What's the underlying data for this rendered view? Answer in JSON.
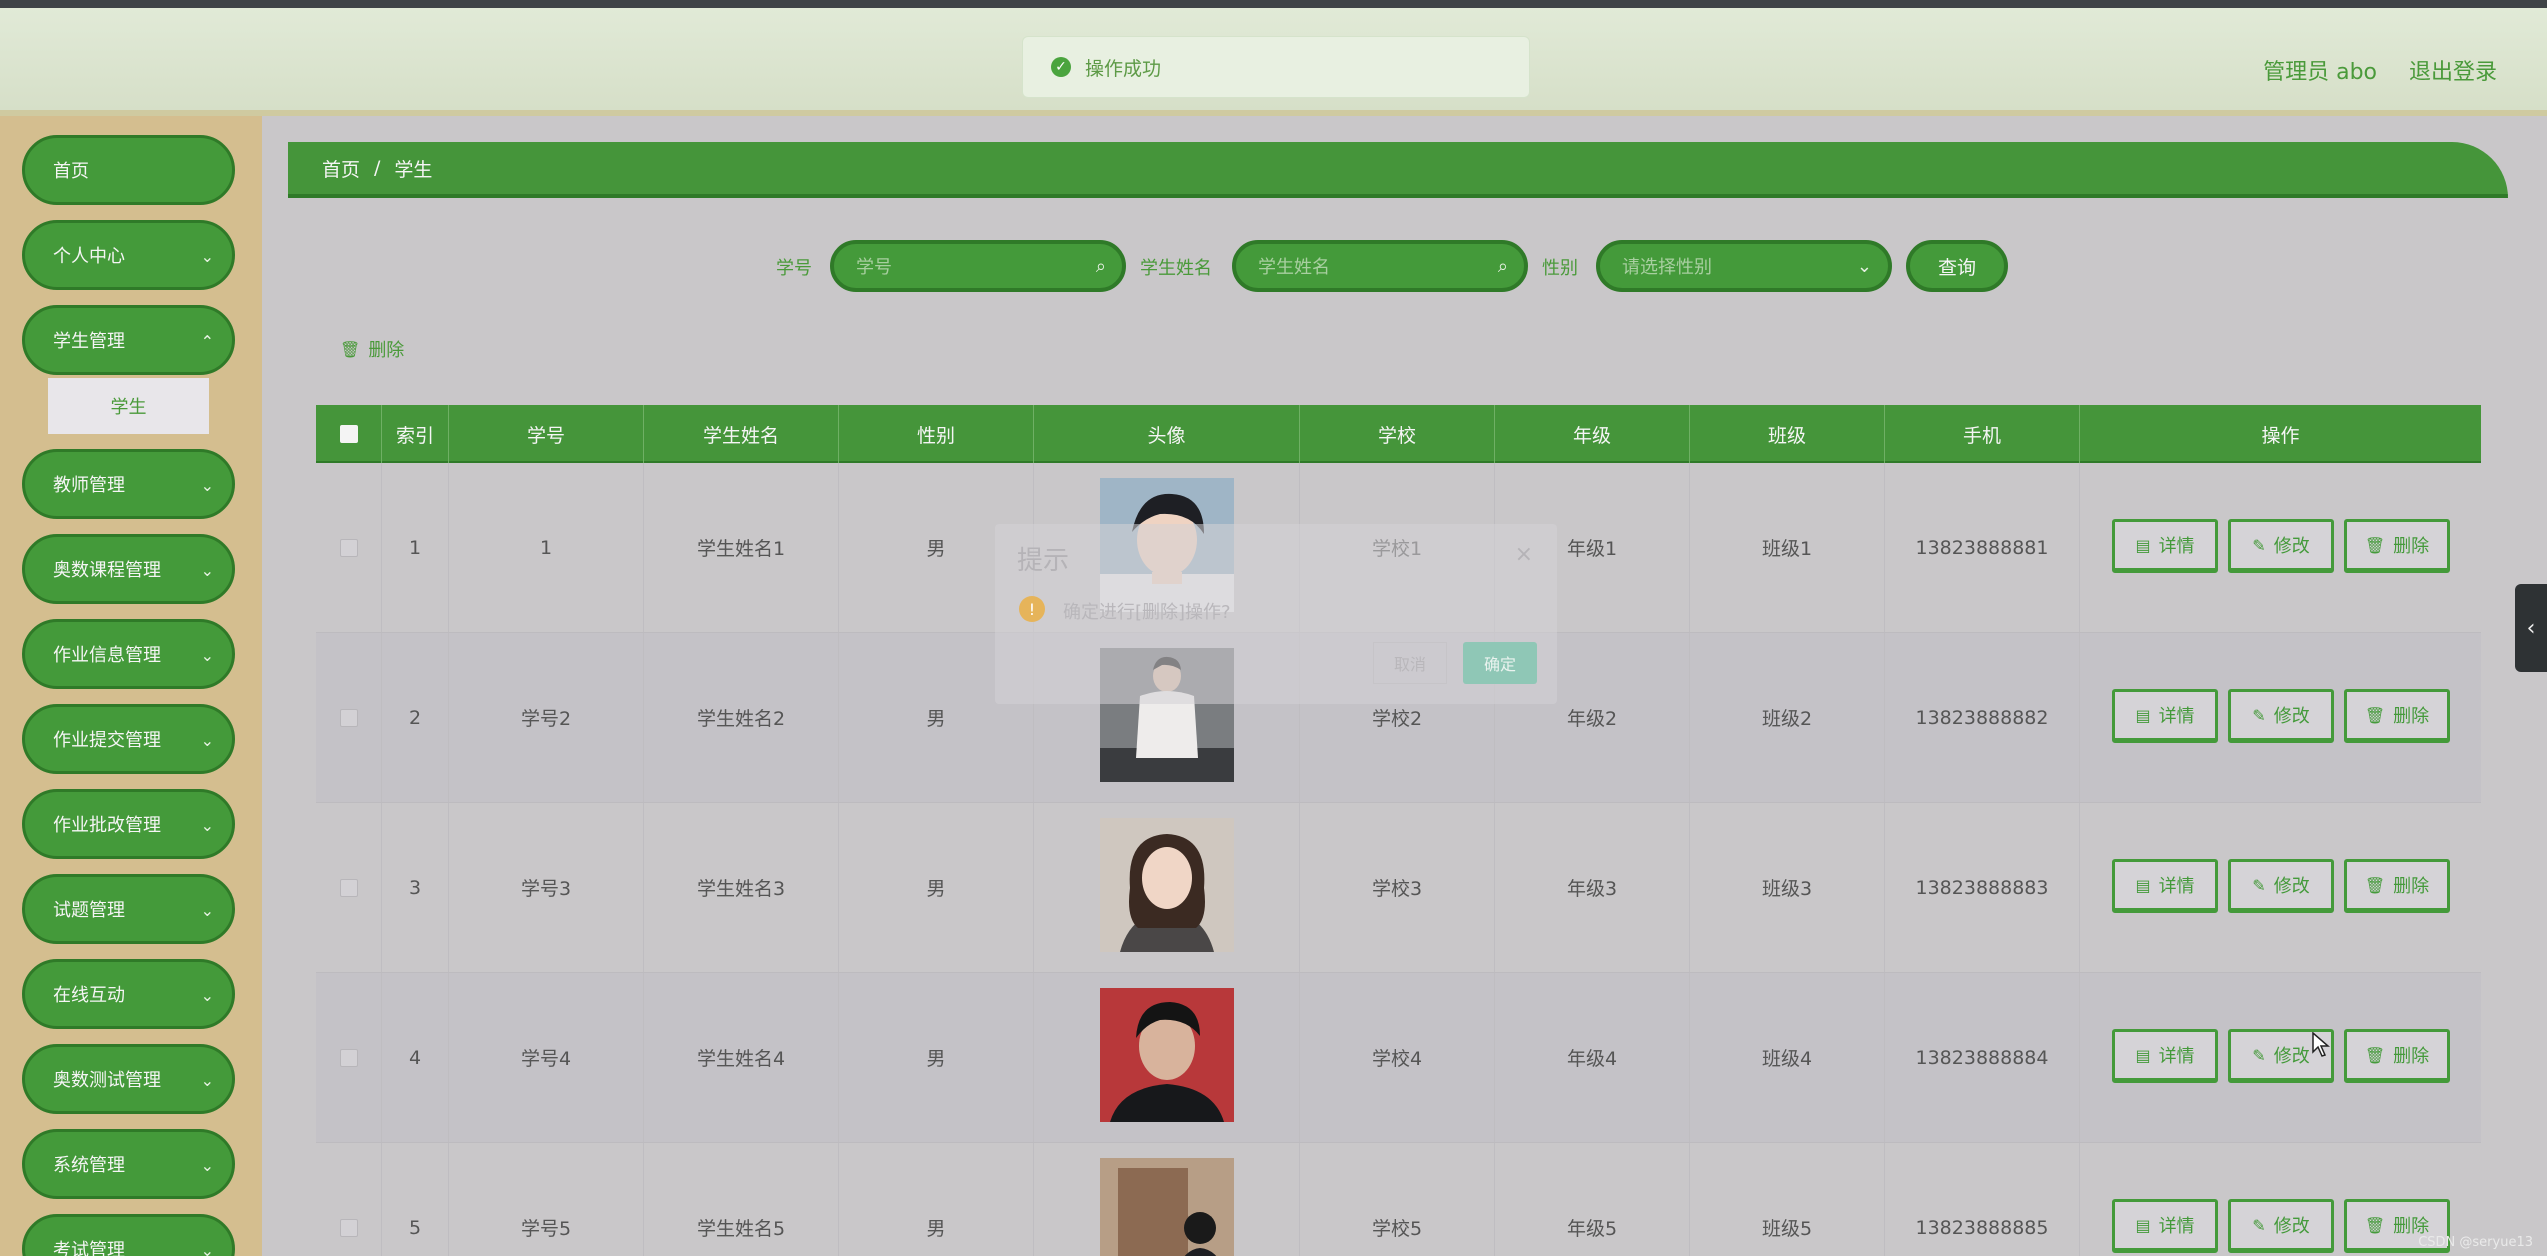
{
  "header": {
    "user": "管理员 abo",
    "logout": "退出登录"
  },
  "toast": {
    "text": "操作成功"
  },
  "sidebar": {
    "items": [
      {
        "label": "首页",
        "has_arrow": false
      },
      {
        "label": "个人中心",
        "has_arrow": true
      },
      {
        "label": "学生管理",
        "has_arrow": true
      },
      {
        "label": "教师管理",
        "has_arrow": true
      },
      {
        "label": "奥数课程管理",
        "has_arrow": true
      },
      {
        "label": "作业信息管理",
        "has_arrow": true
      },
      {
        "label": "作业提交管理",
        "has_arrow": true
      },
      {
        "label": "作业批改管理",
        "has_arrow": true
      },
      {
        "label": "试题管理",
        "has_arrow": true
      },
      {
        "label": "在线互动",
        "has_arrow": true
      },
      {
        "label": "奥数测试管理",
        "has_arrow": true
      },
      {
        "label": "系统管理",
        "has_arrow": true
      },
      {
        "label": "考试管理",
        "has_arrow": true
      }
    ],
    "sub_item": "学生"
  },
  "breadcrumb": {
    "home": "首页",
    "sep": "/",
    "current": "学生"
  },
  "search": {
    "id_label": "学号",
    "id_placeholder": "学号",
    "name_label": "学生姓名",
    "name_placeholder": "学生姓名",
    "gender_label": "性别",
    "gender_placeholder": "请选择性别",
    "query_button": "查询"
  },
  "actions": {
    "delete": "删除"
  },
  "table": {
    "headers": [
      "索引",
      "学号",
      "学生姓名",
      "性别",
      "头像",
      "学校",
      "年级",
      "班级",
      "手机",
      "操作"
    ],
    "rows": [
      {
        "index": "1",
        "id": "1",
        "name": "学生姓名1",
        "gender": "男",
        "school": "学校1",
        "grade": "年级1",
        "class": "班级1",
        "phone": "13823888881"
      },
      {
        "index": "2",
        "id": "学号2",
        "name": "学生姓名2",
        "gender": "男",
        "school": "学校2",
        "grade": "年级2",
        "class": "班级2",
        "phone": "13823888882"
      },
      {
        "index": "3",
        "id": "学号3",
        "name": "学生姓名3",
        "gender": "男",
        "school": "学校3",
        "grade": "年级3",
        "class": "班级3",
        "phone": "13823888883"
      },
      {
        "index": "4",
        "id": "学号4",
        "name": "学生姓名4",
        "gender": "男",
        "school": "学校4",
        "grade": "年级4",
        "class": "班级4",
        "phone": "13823888884"
      },
      {
        "index": "5",
        "id": "学号5",
        "name": "学生姓名5",
        "gender": "男",
        "school": "学校5",
        "grade": "年级5",
        "class": "班级5",
        "phone": "13823888885"
      }
    ],
    "row_buttons": {
      "detail": "详情",
      "edit": "修改",
      "delete": "删除"
    }
  },
  "dialog": {
    "title": "提示",
    "message": "确定进行[删除]操作?",
    "cancel": "取消",
    "confirm": "确定"
  },
  "watermark": "CSDN @seryue13",
  "colors": {
    "primary": "#449a3a",
    "primary_dark": "#2f7a28",
    "sidebar_bg": "#d4be8f",
    "page_bg": "#c9c7c9"
  }
}
